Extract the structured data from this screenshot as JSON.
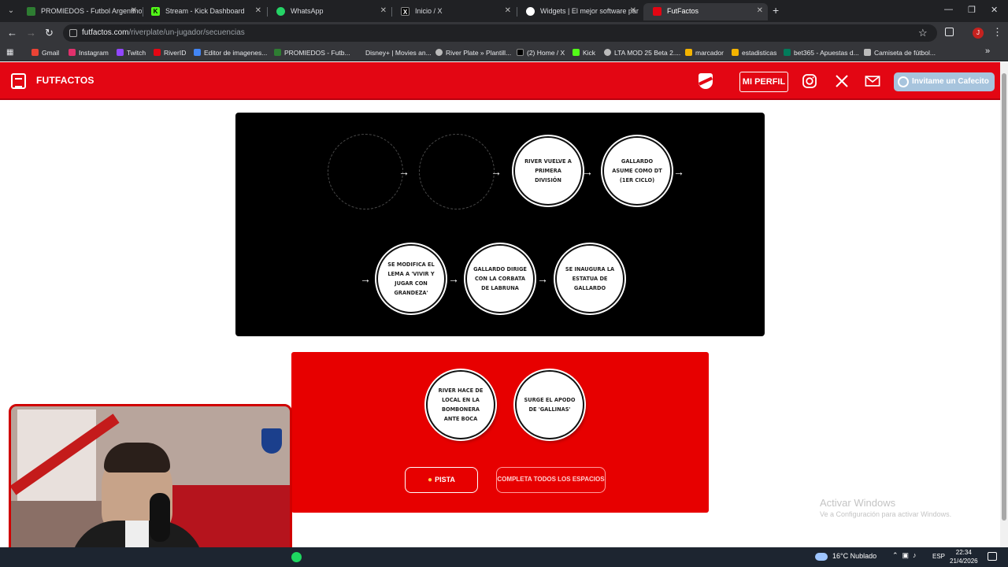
{
  "browser": {
    "tabs": [
      {
        "title": "PROMIEDOS - Futbol Argentino",
        "favicon_color": "#2e7d32",
        "active": false
      },
      {
        "title": "Stream - Kick Dashboard",
        "favicon_color": "#53fc18",
        "active": false
      },
      {
        "title": "WhatsApp",
        "favicon_color": "#25d366",
        "active": false
      },
      {
        "title": "Inicio / X",
        "favicon_color": "#000000",
        "active": false
      },
      {
        "title": "Widgets | El mejor software par",
        "favicon_color": "#ffffff",
        "active": false
      },
      {
        "title": "FutFactos",
        "favicon_color": "#e30613",
        "active": true
      }
    ],
    "url_domain": "futfactos.com",
    "url_path": "/riverplate/un-jugador/secuencias",
    "profile_initial": "J",
    "bookmarks": [
      {
        "label": "Gmail",
        "icon": "gmail-icon",
        "color": "#ea4335"
      },
      {
        "label": "Instagram",
        "icon": "instagram-icon",
        "color": "#e1306c"
      },
      {
        "label": "Twitch",
        "icon": "twitch-icon",
        "color": "#9146ff"
      },
      {
        "label": "RiverID",
        "icon": "river-icon",
        "color": "#e30613"
      },
      {
        "label": "Editor de imagenes...",
        "icon": "image-editor-icon",
        "color": "#4285f4"
      },
      {
        "label": "PROMIEDOS - Futb...",
        "icon": "promiedos-icon",
        "color": "#2e7d32"
      },
      {
        "label": "Disney+ | Movies an...",
        "icon": "",
        "color": ""
      },
      {
        "label": "River Plate » Plantill...",
        "icon": "globe-icon",
        "color": "#bbbbbb"
      },
      {
        "label": "(2) Home / X",
        "icon": "x-icon",
        "color": "#000000"
      },
      {
        "label": "Kick",
        "icon": "kick-icon",
        "color": "#53fc18"
      },
      {
        "label": "LTA MOD 25 Beta 2....",
        "icon": "globe-icon",
        "color": "#bbbbbb"
      },
      {
        "label": "marcador",
        "icon": "bookmark-icon",
        "color": "#f4b400"
      },
      {
        "label": "estadisticas",
        "icon": "bookmark-icon",
        "color": "#f4b400"
      },
      {
        "label": "bet365 - Apuestas d...",
        "icon": "bet365-icon",
        "color": "#027b5b"
      },
      {
        "label": "Camiseta de fútbol...",
        "icon": "shirt-icon",
        "color": "#bbbbbb"
      }
    ]
  },
  "site": {
    "brand": "FUTFACTOS",
    "profile_button": "MI PERFIL",
    "coffee_button": "Invitame un Cafecito",
    "accent": "#e30613"
  },
  "sequence": {
    "row1": [
      {
        "text": ""
      },
      {
        "text": ""
      },
      {
        "text": "RIVER VUELVE A PRIMERA DIVISIÓN"
      },
      {
        "text": "GALLARDO ASUME COMO DT (1ER CICLO)"
      }
    ],
    "row2": [
      {
        "text": "SE MODIFICA EL LEMA A 'VIVIR Y JUGAR CON GRANDEZA'"
      },
      {
        "text": "GALLARDO DIRIGE CON LA CORBATA DE LABRUNA"
      },
      {
        "text": "SE INAUGURA LA ESTATUA DE GALLARDO"
      }
    ],
    "arrow": "→"
  },
  "options": [
    {
      "text": "RIVER HACE DE LOCAL EN LA BOMBONERA ANTE BOCA"
    },
    {
      "text": "SURGE EL APODO DE 'GALLINAS'"
    }
  ],
  "actions": {
    "hint": "PISTA",
    "complete": "COMPLETA TODOS LOS ESPACIOS"
  },
  "watermark": {
    "title": "Activar Windows",
    "subtitle": "Ve a Configuración para activar Windows."
  },
  "taskbar": {
    "weather": "16°C  Nublado",
    "lang": "ESP",
    "time": "22:34",
    "date": "21/4/2026"
  }
}
